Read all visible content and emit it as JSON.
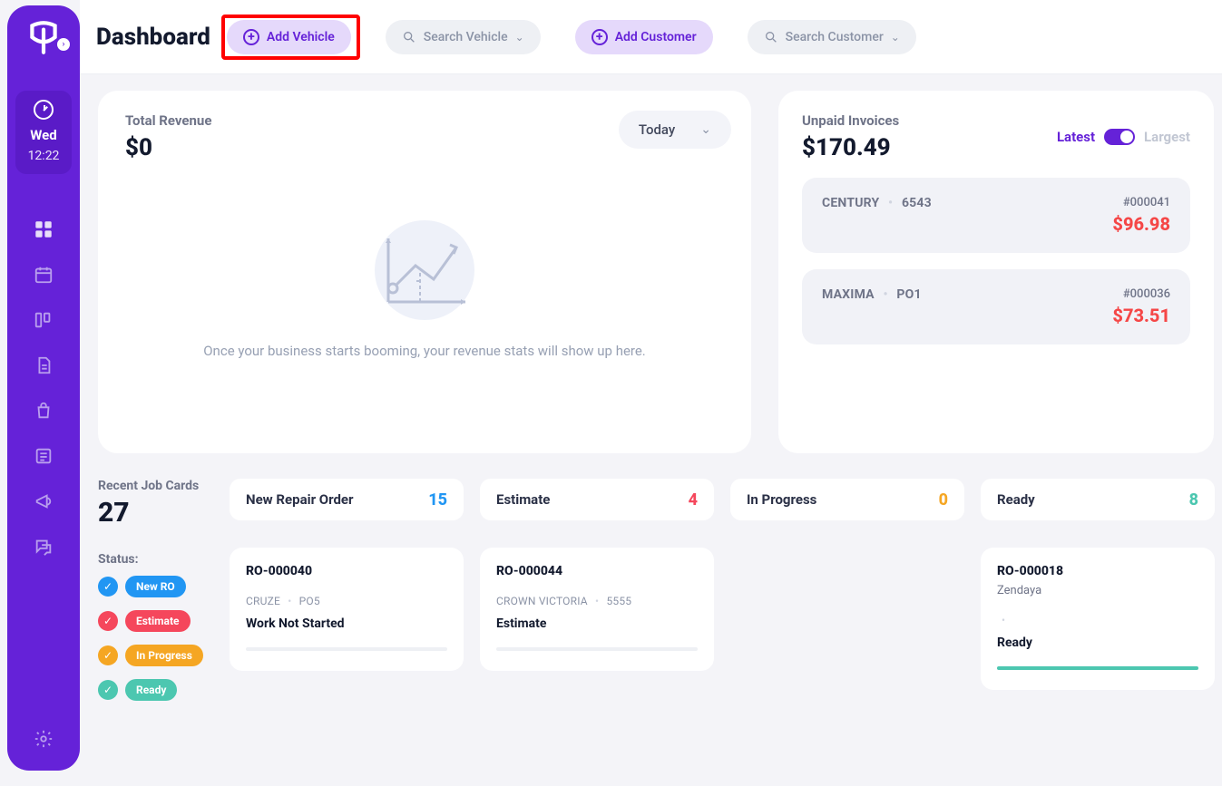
{
  "sidebar": {
    "day": "Wed",
    "time": "12:22"
  },
  "header": {
    "title": "Dashboard",
    "add_vehicle": "Add Vehicle",
    "search_vehicle": "Search Vehicle",
    "add_customer": "Add Customer",
    "search_customer": "Search Customer"
  },
  "revenue": {
    "label": "Total Revenue",
    "amount": "$0",
    "period": "Today",
    "placeholder_text": "Once your business starts booming, your revenue stats will show up here."
  },
  "unpaid": {
    "label": "Unpaid Invoices",
    "total": "$170.49",
    "toggle_latest": "Latest",
    "toggle_largest": "Largest",
    "items": [
      {
        "model": "CENTURY",
        "code": "6543",
        "invoice_no": "#000041",
        "amount": "$96.98"
      },
      {
        "model": "MAXIMA",
        "code": "PO1",
        "invoice_no": "#000036",
        "amount": "$73.51"
      }
    ]
  },
  "jobcards": {
    "label": "Recent Job Cards",
    "count": "27",
    "status_label": "Status:",
    "statuses": [
      {
        "name": "New RO",
        "color": "blue"
      },
      {
        "name": "Estimate",
        "color": "red"
      },
      {
        "name": "In Progress",
        "color": "orange"
      },
      {
        "name": "Ready",
        "color": "teal"
      }
    ],
    "lanes": [
      {
        "name": "New Repair Order",
        "count": "15",
        "color": "c-blue"
      },
      {
        "name": "Estimate",
        "count": "4",
        "color": "c-red"
      },
      {
        "name": "In Progress",
        "count": "0",
        "color": "c-orange"
      },
      {
        "name": "Ready",
        "count": "8",
        "color": "c-teal"
      }
    ],
    "cards": {
      "new_repair": {
        "ro": "RO-000040",
        "veh_model": "CRUZE",
        "veh_code": "PO5",
        "status": "Work Not Started"
      },
      "estimate": {
        "ro": "RO-000044",
        "veh_model": "CROWN VICTORIA",
        "veh_code": "5555",
        "status": "Estimate"
      },
      "ready": {
        "ro": "RO-000018",
        "customer": "Zendaya",
        "status": "Ready"
      }
    }
  }
}
